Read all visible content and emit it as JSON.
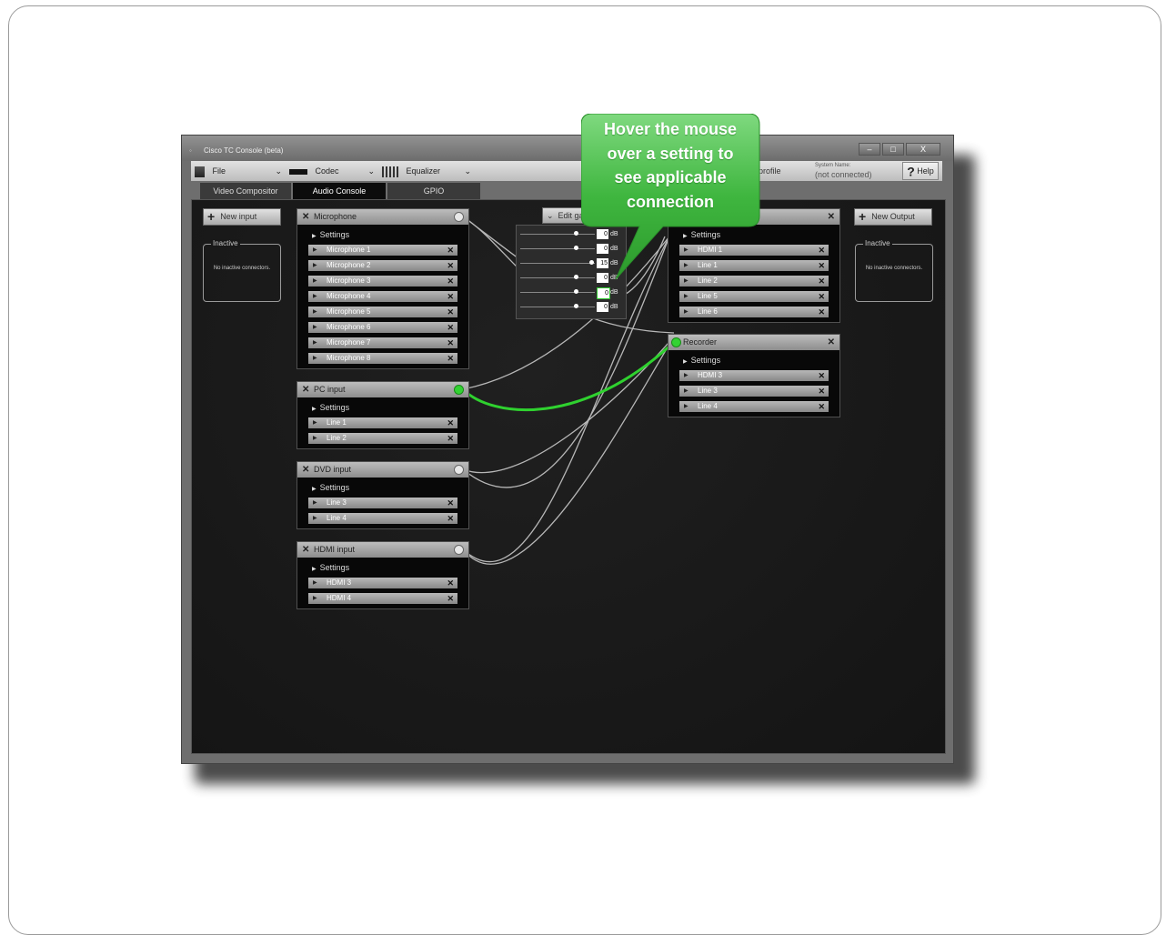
{
  "window": {
    "title": "Cisco TC Console (beta)",
    "controls": [
      "–",
      "□",
      "X"
    ]
  },
  "toolbar": {
    "file_label": "File",
    "codec_label": "Codec",
    "equalizer_label": "Equalizer",
    "profile_label": "profile",
    "system_name_label": "System Name:",
    "system_name_value": "(not connected)",
    "help_label": "Help"
  },
  "tabs": [
    "Video Compositor",
    "Audio Console",
    "GPIO"
  ],
  "active_tab": "Audio Console",
  "left_panel": {
    "new_input_label": "New input",
    "inactive_label": "Inactive",
    "inactive_msg": "No inactive connectors."
  },
  "right_panel": {
    "new_output_label": "New Output",
    "inactive_label": "Inactive",
    "inactive_msg": "No inactive connectors."
  },
  "settings_label": "Settings",
  "inputs": [
    {
      "name": "Microphone",
      "items": [
        "Microphone 1",
        "Microphone 2",
        "Microphone 3",
        "Microphone 4",
        "Microphone 5",
        "Microphone 6",
        "Microphone 7",
        "Microphone 8"
      ]
    },
    {
      "name": "PC input",
      "items": [
        "Line 1",
        "Line 2"
      ]
    },
    {
      "name": "DVD input",
      "items": [
        "Line 3",
        "Line 4"
      ]
    },
    {
      "name": "HDMI input",
      "items": [
        "HDMI 3",
        "HDMI 4"
      ]
    }
  ],
  "outputs": [
    {
      "name": "",
      "items": [
        "HDMI 1",
        "Line 1",
        "Line 2",
        "Line 5",
        "Line 6"
      ]
    },
    {
      "name": "Recorder",
      "items": [
        "HDMI 3",
        "Line 3",
        "Line 4"
      ]
    }
  ],
  "gain": {
    "edit_label": "Edit ga",
    "unit": "dB",
    "rows": [
      {
        "value": "0"
      },
      {
        "value": "0"
      },
      {
        "value": "15"
      },
      {
        "value": "0"
      },
      {
        "value": "0"
      },
      {
        "value": "0"
      }
    ]
  },
  "callout": {
    "lines": [
      "Hover the mouse",
      "over a setting to",
      "see applicable",
      "connection"
    ]
  },
  "colors": {
    "highlight_wire": "#2fd12f",
    "callout_green": "#3fb63f",
    "wire": "#c8c8c8"
  }
}
